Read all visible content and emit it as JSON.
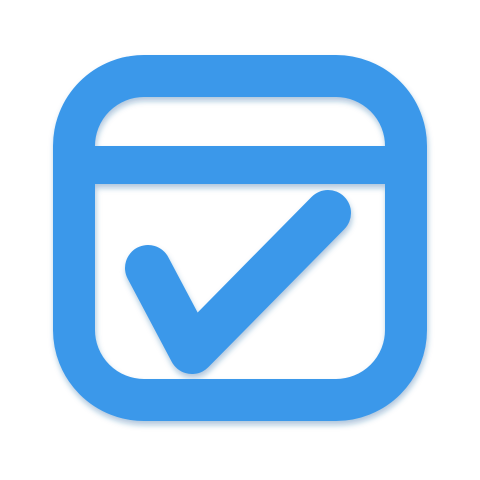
{
  "icon": {
    "name": "calendar-check-icon",
    "colors": {
      "stroke": "#3a98ea",
      "background": "#ffffff",
      "shadow": "#1f5f9c"
    }
  }
}
